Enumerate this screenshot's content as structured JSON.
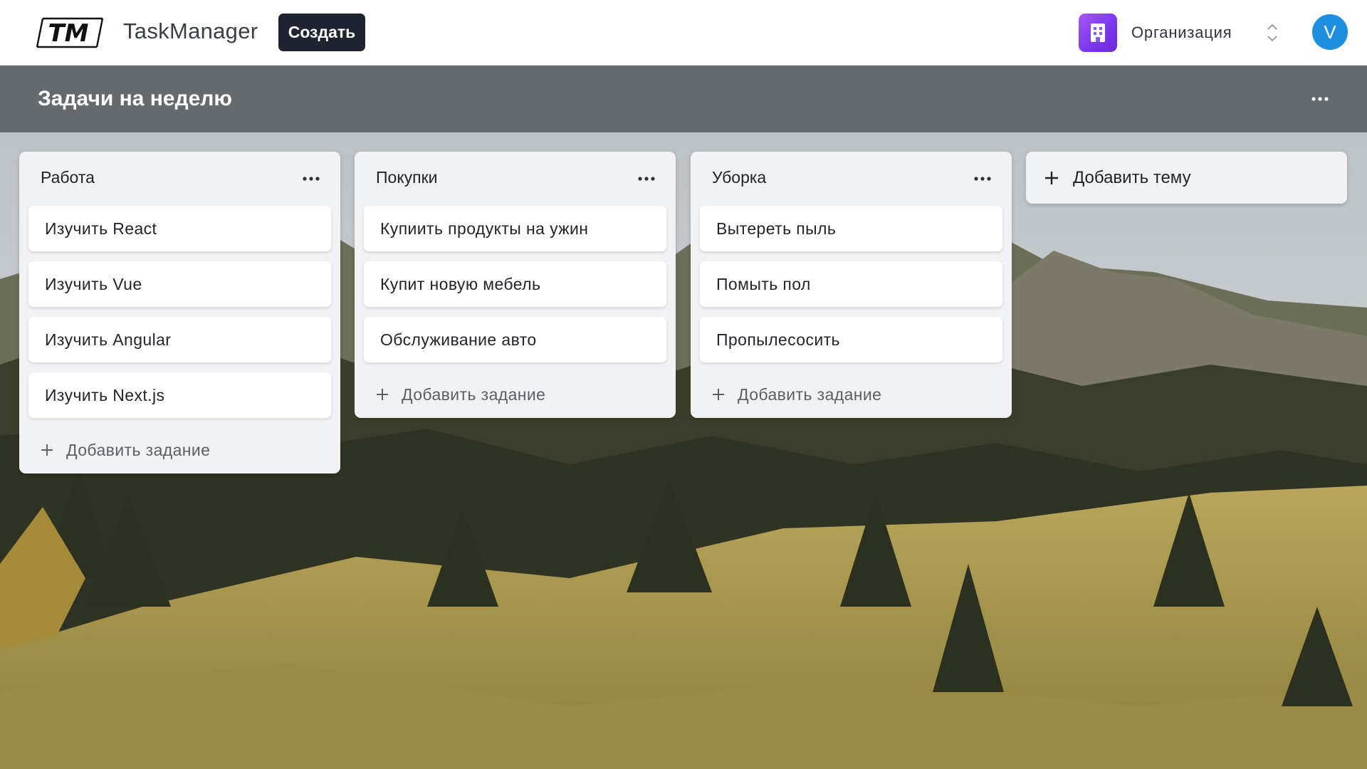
{
  "navbar": {
    "logo_text": "TM",
    "app_name": "TaskManager",
    "create_label": "Создать",
    "org_label": "Организация",
    "avatar_letter": "V"
  },
  "board": {
    "title": "Задачи на неделю"
  },
  "lists": [
    {
      "title": "Работа",
      "cards": [
        "Изучить React",
        "Изучить Vue",
        "Изучить Angular",
        "Изучить Next.js"
      ],
      "add_label": "Добавить задание"
    },
    {
      "title": "Покупки",
      "cards": [
        "Купиить продукты на ужин",
        "Купит новую мебель",
        "Обслуживание авто"
      ],
      "add_label": "Добавить задание"
    },
    {
      "title": "Уборка",
      "cards": [
        "Вытереть пыль",
        "Помыть пол",
        "Пропылесосить"
      ],
      "add_label": "Добавить задание"
    }
  ],
  "add_theme_label": "Добавить тему",
  "icons": {
    "org": "building-icon",
    "switch": "chevron-updown-icon",
    "menu": "more-horizontal-icon",
    "add": "plus-icon"
  },
  "colors": {
    "primary_button": "#1f2430",
    "org_accent": "#8b5cf6",
    "avatar": "#1d8ee0",
    "board_header": "#5f6368"
  }
}
